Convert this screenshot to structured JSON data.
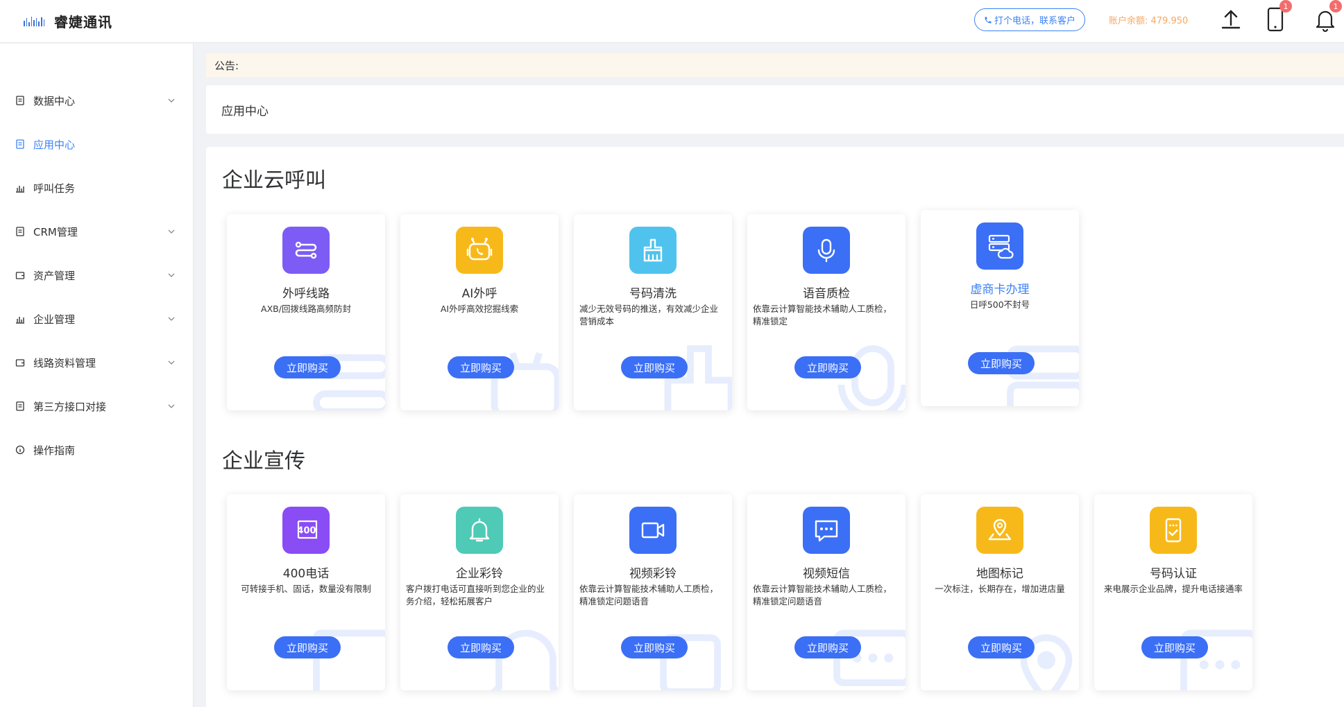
{
  "header": {
    "brand": "睿婕通讯",
    "call_button": "打个电话，联系客户",
    "balance": "账户余额: 479.950",
    "device_badge": "1",
    "bell_badge": "1",
    "colors": {
      "accent": "#3b82f6",
      "balance": "#f5a862",
      "badge": "#f56c6c"
    }
  },
  "sidebar": {
    "items": [
      {
        "label": "数据中心",
        "icon": "document-icon",
        "expandable": true,
        "active": false
      },
      {
        "label": "应用中心",
        "icon": "document-icon",
        "expandable": false,
        "active": true
      },
      {
        "label": "呼叫任务",
        "icon": "bar-chart-icon",
        "expandable": false,
        "active": false
      },
      {
        "label": "CRM管理",
        "icon": "document-icon",
        "expandable": true,
        "active": false
      },
      {
        "label": "资产管理",
        "icon": "wallet-icon",
        "expandable": true,
        "active": false
      },
      {
        "label": "企业管理",
        "icon": "bar-chart-icon",
        "expandable": true,
        "active": false
      },
      {
        "label": "线路资料管理",
        "icon": "wallet-icon",
        "expandable": true,
        "active": false
      },
      {
        "label": "第三方接口对接",
        "icon": "document-icon",
        "expandable": true,
        "active": false
      },
      {
        "label": "操作指南",
        "icon": "info-icon",
        "expandable": false,
        "active": false
      }
    ]
  },
  "notice": {
    "label": "公告:"
  },
  "breadcrumb": {
    "title": "应用中心"
  },
  "sections": [
    {
      "title": "企业云呼叫",
      "products": [
        {
          "name": "外呼线路",
          "desc": "AXB/回拨线路高频防封",
          "icon": "route-icon",
          "color": "#7c5cf5",
          "button": "立即购买"
        },
        {
          "name": "AI外呼",
          "desc": "AI外呼高效挖掘线索",
          "icon": "robot-phone-icon",
          "color": "#f7b91a",
          "button": "立即购买"
        },
        {
          "name": "号码清洗",
          "desc": "减少无效号码的推送，有效减少企业营销成本",
          "icon": "broom-icon",
          "color": "#4fc3ee",
          "button": "立即购买"
        },
        {
          "name": "语音质检",
          "desc": "依靠云计算智能技术辅助人工质检，精准锁定",
          "icon": "microphone-icon",
          "color": "#3b6ff5",
          "button": "立即购买"
        },
        {
          "name": "虚商卡办理",
          "desc": "日呼500不封号",
          "icon": "cloud-server-icon",
          "color": "#3b6ff5",
          "button": "立即购买"
        }
      ]
    },
    {
      "title": "企业宣传",
      "products": [
        {
          "name": "400电话",
          "desc": "可转接手机、固话，数量没有限制",
          "icon": "phone-400-icon",
          "color": "#8a4cf5",
          "button": "立即购买"
        },
        {
          "name": "企业彩铃",
          "desc": "客户拨打电话可直接听到您企业的业务介绍，轻松拓展客户",
          "icon": "bell-icon",
          "color": "#4ecab6",
          "button": "立即购买"
        },
        {
          "name": "视频彩铃",
          "desc": "依靠云计算智能技术辅助人工质检，精准锁定问题语音",
          "icon": "video-camera-icon",
          "color": "#3b6ff5",
          "button": "立即购买"
        },
        {
          "name": "视频短信",
          "desc": "依靠云计算智能技术辅助人工质检，精准锁定问题语音",
          "icon": "chat-bubble-icon",
          "color": "#3b6ff5",
          "button": "立即购买"
        },
        {
          "name": "地图标记",
          "desc": "一次标注，长期存在，增加进店量",
          "icon": "map-pin-icon",
          "color": "#f7b91a",
          "button": "立即购买"
        },
        {
          "name": "号码认证",
          "desc": "来电展示企业品牌，提升电话接通率",
          "icon": "verified-phone-icon",
          "color": "#f7b91a",
          "button": "立即购买"
        }
      ]
    }
  ]
}
